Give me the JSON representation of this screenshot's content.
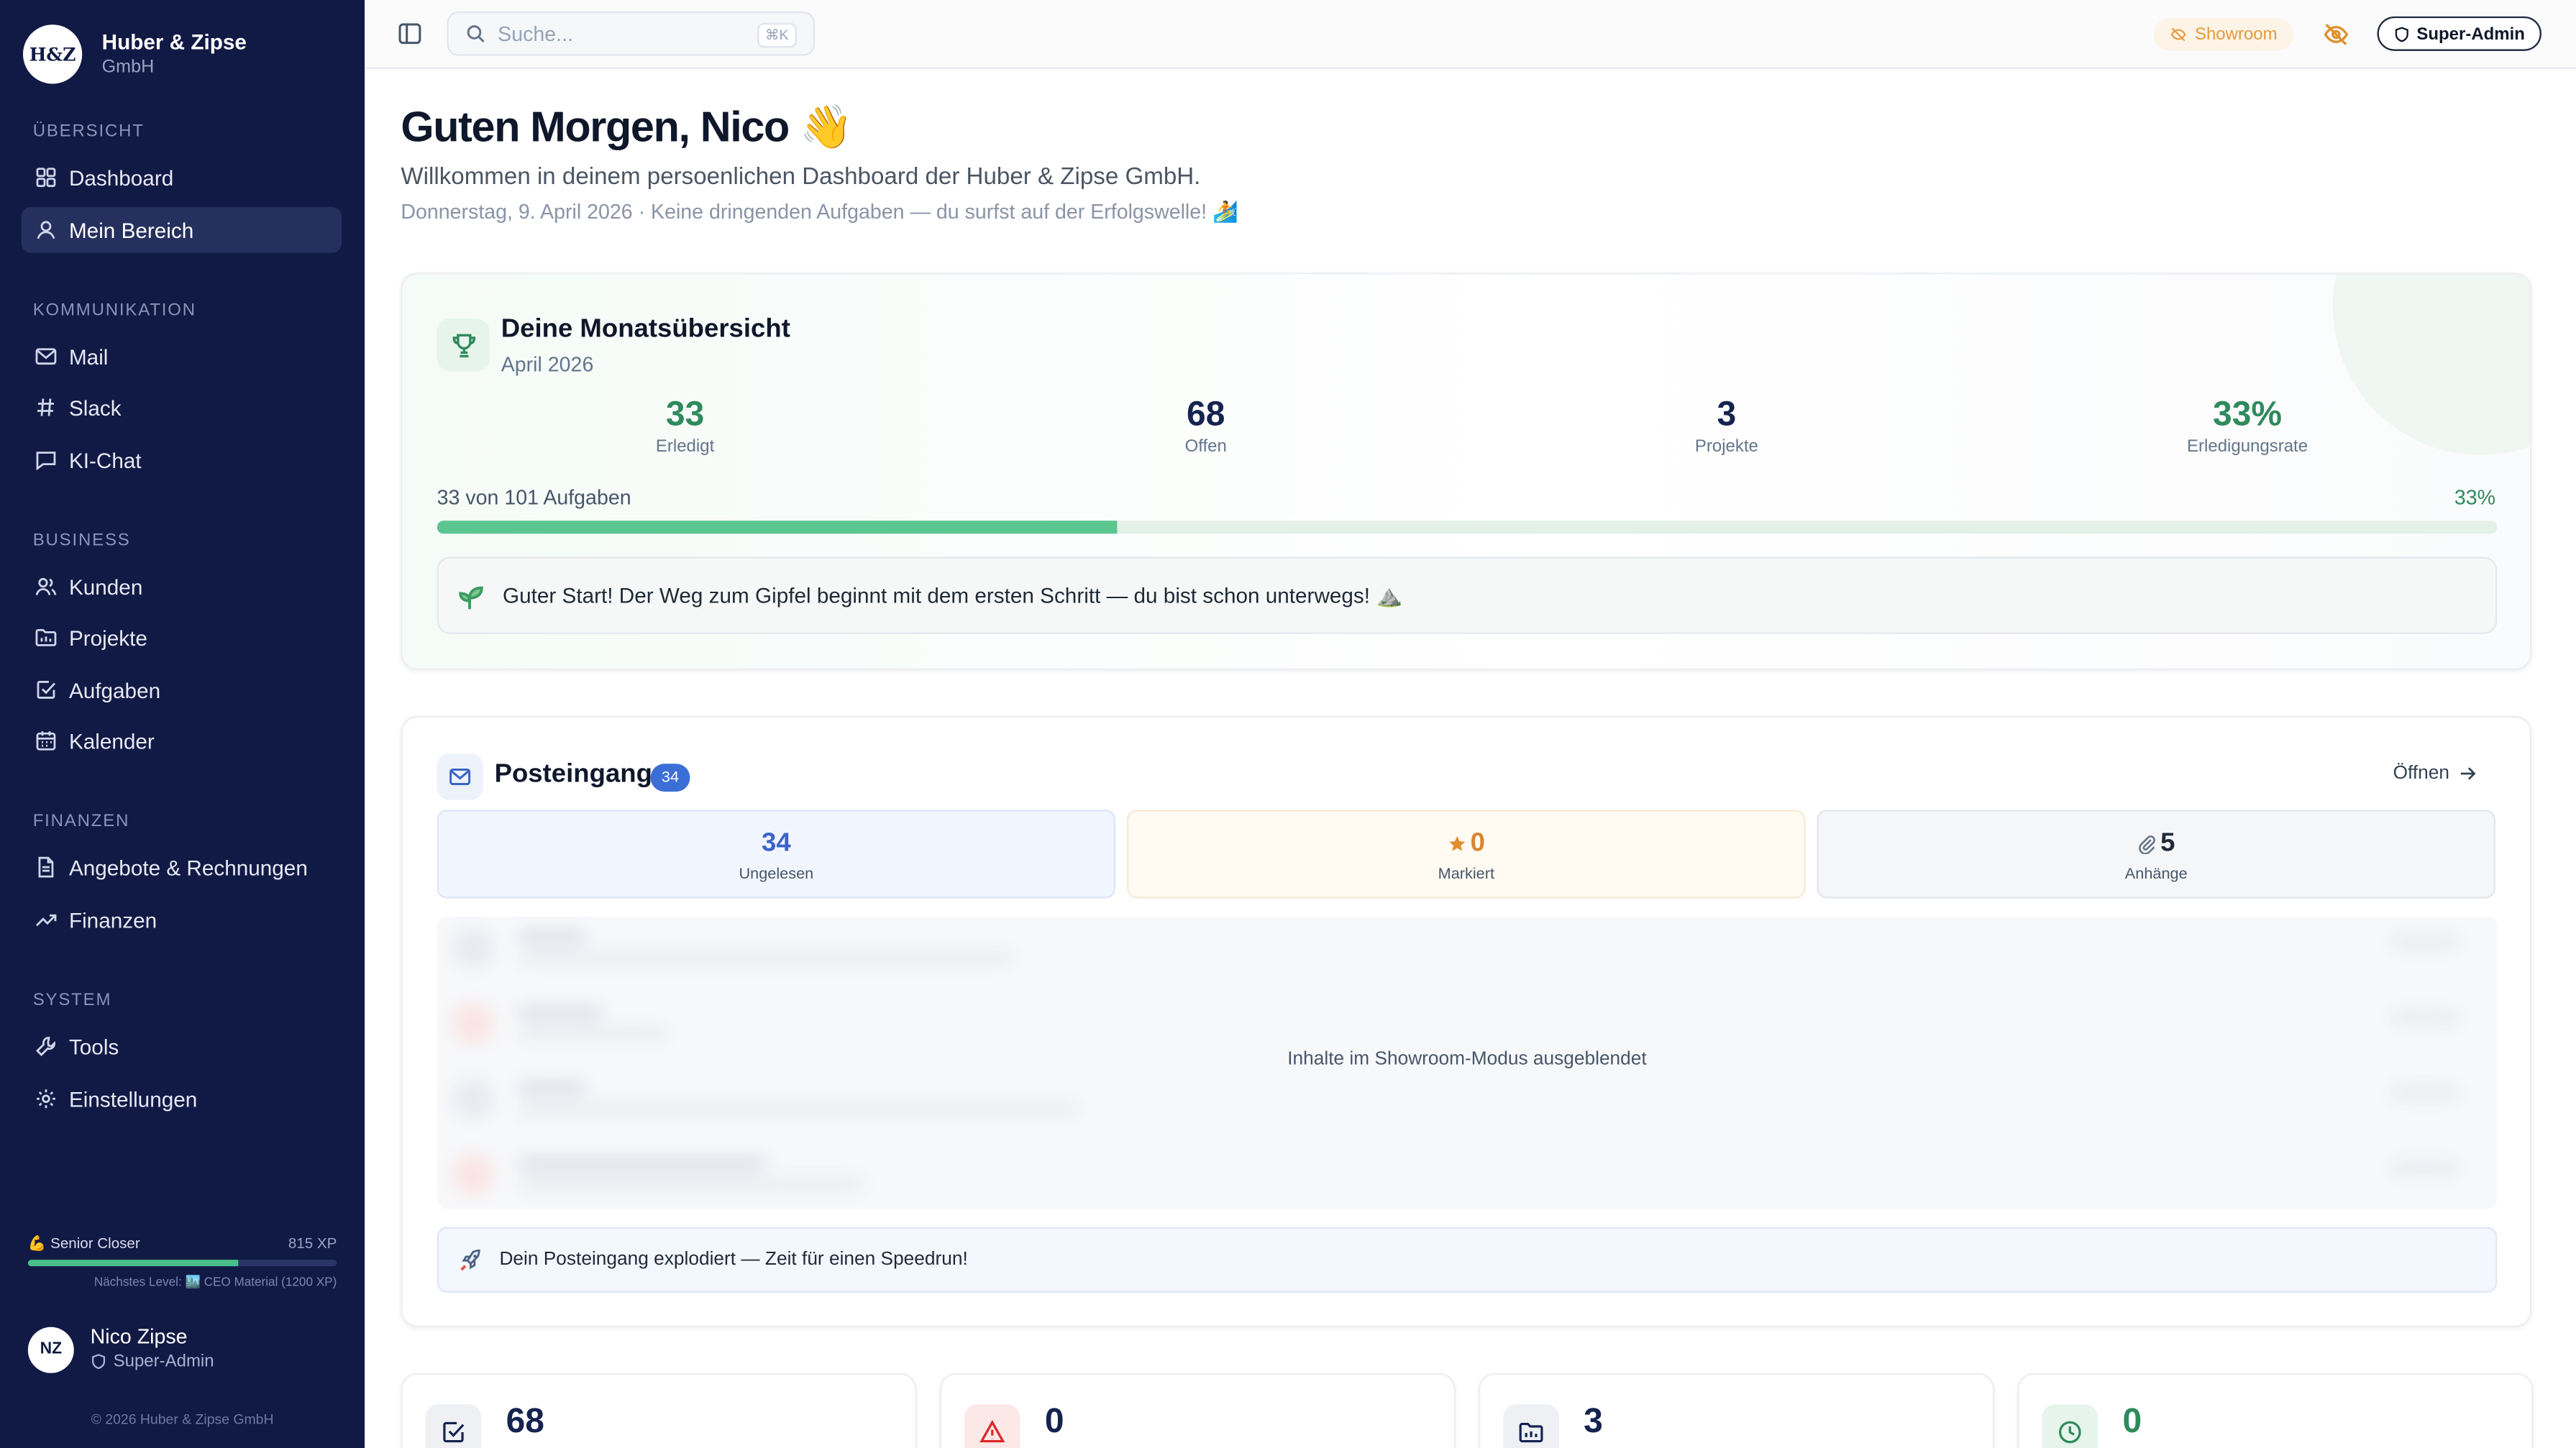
{
  "brand": {
    "logo": "H&Z",
    "name": "Huber & Zipse",
    "sub": "GmbH"
  },
  "sidebar": {
    "sections": [
      {
        "title": "ÜBERSICHT",
        "items": [
          {
            "label": "Dashboard",
            "icon": "layout-grid-icon"
          },
          {
            "label": "Mein Bereich",
            "icon": "user-icon",
            "active": true
          }
        ]
      },
      {
        "title": "KOMMUNIKATION",
        "items": [
          {
            "label": "Mail",
            "icon": "mail-icon"
          },
          {
            "label": "Slack",
            "icon": "hash-icon"
          },
          {
            "label": "KI-Chat",
            "icon": "chat-icon"
          }
        ]
      },
      {
        "title": "BUSINESS",
        "items": [
          {
            "label": "Kunden",
            "icon": "users-icon"
          },
          {
            "label": "Projekte",
            "icon": "folder-icon"
          },
          {
            "label": "Aufgaben",
            "icon": "check-square-icon"
          },
          {
            "label": "Kalender",
            "icon": "calendar-icon"
          }
        ]
      },
      {
        "title": "FINANZEN",
        "items": [
          {
            "label": "Angebote & Rechnungen",
            "icon": "file-icon"
          },
          {
            "label": "Finanzen",
            "icon": "trending-up-icon"
          }
        ]
      },
      {
        "title": "SYSTEM",
        "items": [
          {
            "label": "Tools",
            "icon": "wrench-icon"
          },
          {
            "label": "Einstellungen",
            "icon": "gear-icon"
          }
        ]
      }
    ],
    "xp": {
      "level": "💪 Senior Closer",
      "points": "815 XP",
      "progress": 0.68,
      "next": "Nächstes Level: 🏙️ CEO Material (1200 XP)"
    },
    "user": {
      "initials": "NZ",
      "name": "Nico Zipse",
      "role": "Super-Admin"
    },
    "copyright": "© 2026 Huber & Zipse GmbH"
  },
  "topbar": {
    "search_placeholder": "Suche...",
    "search_shortcut": "⌘K",
    "showroom_label": "Showroom",
    "admin_label": "Super-Admin"
  },
  "hero": {
    "greeting": "Guten Morgen, Nico 👋",
    "welcome": "Willkommen in deinem persoenlichen Dashboard der Huber & Zipse GmbH.",
    "subline": "Donnerstag, 9. April 2026 · Keine dringenden Aufgaben — du surfst auf der Erfolgswelle! 🏄"
  },
  "month": {
    "title": "Deine Monatsübersicht",
    "period": "April 2026",
    "stats": [
      {
        "value": "33",
        "label": "Erledigt",
        "color": "#2f8a5c"
      },
      {
        "value": "68",
        "label": "Offen",
        "color": "#15234f"
      },
      {
        "value": "3",
        "label": "Projekte",
        "color": "#15234f"
      },
      {
        "value": "33%",
        "label": "Erledigungsrate",
        "color": "#2f8a5c"
      }
    ],
    "progress_label": "33 von 101 Aufgaben",
    "progress_pct": "33%",
    "progress": 0.33,
    "motivation": "Guter Start! Der Weg zum Gipfel beginnt mit dem ersten Schritt — du bist schon unterwegs! ⛰️"
  },
  "inbox": {
    "title": "Posteingang",
    "badge": "34",
    "open_label": "Öffnen",
    "unread": {
      "value": "34",
      "label": "Ungelesen"
    },
    "marked": {
      "value": "0",
      "label": "Markiert"
    },
    "attachments": {
      "value": "5",
      "label": "Anhänge"
    },
    "hidden_message": "Inhalte im Showroom-Modus ausgeblendet",
    "footer": "Dein Posteingang explodiert — Zeit für einen Speedrun!"
  },
  "mini_stats": [
    {
      "value": "68",
      "icon": "check-square-icon",
      "color": "#15234f",
      "bg": "#eef0f4"
    },
    {
      "value": "0",
      "icon": "alert-triangle-icon",
      "color": "#15234f",
      "bg": "#fde8e8"
    },
    {
      "value": "3",
      "icon": "folder-icon",
      "color": "#15234f",
      "bg": "#eef0f4"
    },
    {
      "value": "0",
      "icon": "clock-icon",
      "color": "#2f8a5c",
      "bg": "#e6f4ec"
    }
  ]
}
